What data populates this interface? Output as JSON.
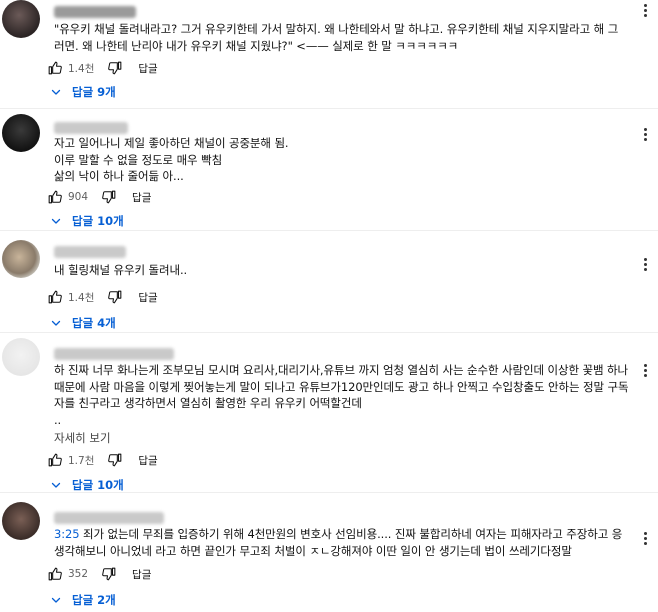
{
  "comments": [
    {
      "text": "\"유우키 채널 돌려내라고? 그거 유우키한테 가서 말하지. 왜 나한테와서 말 하냐고. 유우키한테 채널 지우지말라고 해 그러면. 왜 나한테 난리야 내가 유우키 채널 지웠냐?\" <—— 실제로 한 말 ㅋㅋㅋㅋㅋㅋ",
      "likes": "1.4천",
      "reply_label": "답글",
      "replies": "답글 9개"
    },
    {
      "text": "자고 일어나니 제일 좋아하던 채널이 공중분해 됨.\n이루 말할 수 없을 정도로 매우 빡침\n삶의 낙이 하나 줄어듦 아...",
      "likes": "904",
      "reply_label": "답글",
      "replies": "답글 10개"
    },
    {
      "text": "내 힐링채널 유우키 돌려내..",
      "likes": "1.4천",
      "reply_label": "답글",
      "replies": "답글 4개"
    },
    {
      "text": "하 진짜 너무 화나는게 조부모님 모시며 요리사,대리기사,유튜브 까지 엄청 열심히 사는 순수한 사람인데 이상한 꽃뱀 하나 때문에 사람 마음을 이렇게 찢어놓는게 말이 되나고  유튜브가120만인데도 광고 하나 안찍고 수입창출도 안하는 정말 구독자를 친구라고 생각하면서 열심히 촬영한 우리 유우키 어떡할건데\n..",
      "more": "자세히 보기",
      "likes": "1.7천",
      "reply_label": "답글",
      "replies": "답글 10개"
    },
    {
      "timestamp": "3:25",
      "text": " 죄가 없는데 무죄를 입증하기 위해 4천만원의 변호사 선임비용.... 진짜 불합리하네 여자는 피해자라고 주장하고 응 생각해보니 아니었네 라고 하면 끝인가 무고죄 처벌이 ㅈㄴ강해져야 이딴 일이 안 생기는데 법이 쓰레기다정말",
      "likes": "352",
      "reply_label": "답글",
      "replies": "답글 2개"
    }
  ],
  "colors": {
    "link": "#065fd4",
    "text": "#0f0f0f",
    "meta": "#606060"
  },
  "icons": [
    "avatar",
    "thumb-up-icon",
    "thumb-down-icon",
    "chevron-down-icon",
    "more-vert-icon"
  ]
}
